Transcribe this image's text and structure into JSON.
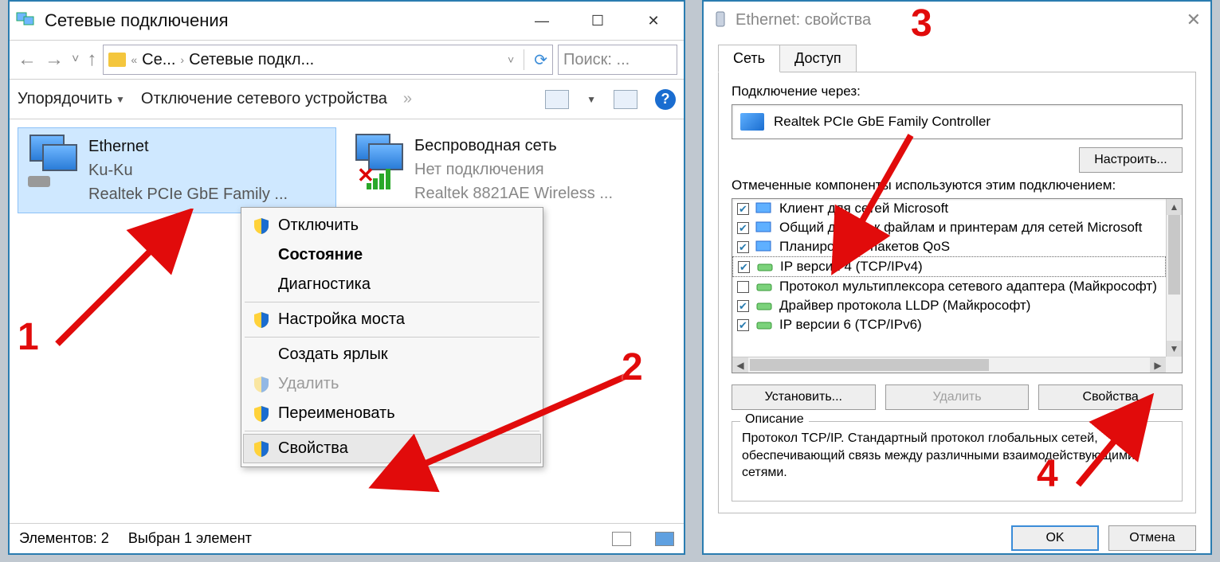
{
  "left_window": {
    "title": "Сетевые подключения",
    "breadcrumb_short": "Се...",
    "breadcrumb_current": "Сетевые подкл...",
    "search_placeholder": "Поиск: ...",
    "toolbar": {
      "organize": "Упорядочить",
      "disable": "Отключение сетевого устройства"
    },
    "connections": [
      {
        "name": "Ethernet",
        "line2": "Ku-Ku",
        "line3": "Realtek PCIe GbE Family ...",
        "selected": true,
        "type": "wired"
      },
      {
        "name": "Беспроводная сеть",
        "line2": "Нет подключения",
        "line3": "Realtek 8821AE Wireless ...",
        "selected": false,
        "type": "wifi_off"
      }
    ],
    "context_menu": [
      {
        "label": "Отключить",
        "shield": true
      },
      {
        "label": "Состояние",
        "bold": true
      },
      {
        "label": "Диагностика"
      },
      {
        "sep": true
      },
      {
        "label": "Настройка моста",
        "shield": true
      },
      {
        "sep": true
      },
      {
        "label": "Создать ярлык"
      },
      {
        "label": "Удалить",
        "shield": true,
        "disabled": true
      },
      {
        "label": "Переименовать",
        "shield": true
      },
      {
        "sep": true
      },
      {
        "label": "Свойства",
        "shield": true,
        "hover": true
      }
    ],
    "statusbar": {
      "elements": "Элементов: 2",
      "selected": "Выбран 1 элемент"
    }
  },
  "right_window": {
    "title": "Ethernet: свойства",
    "tabs": {
      "network": "Сеть",
      "access": "Доступ"
    },
    "connect_via_label": "Подключение через:",
    "adapter": "Realtek PCIe GbE Family Controller",
    "configure_btn": "Настроить...",
    "components_label": "Отмеченные компоненты используются этим подключением:",
    "components": [
      {
        "checked": true,
        "label": "Клиент для сетей Microsoft",
        "ico": "mon"
      },
      {
        "checked": true,
        "label": "Общий доступ к файлам и принтерам для сетей Microsoft",
        "ico": "mon"
      },
      {
        "checked": true,
        "label": "Планировщик пакетов QoS",
        "ico": "mon"
      },
      {
        "checked": true,
        "label": "IP версии 4 (TCP/IPv4)",
        "ico": "net",
        "highlighted": true
      },
      {
        "checked": false,
        "label": "Протокол мультиплексора сетевого адаптера (Майкрософт)",
        "ico": "net"
      },
      {
        "checked": true,
        "label": "Драйвер протокола LLDP (Майкрософт)",
        "ico": "net"
      },
      {
        "checked": true,
        "label": "IP версии 6 (TCP/IPv6)",
        "ico": "net"
      }
    ],
    "btn_install": "Установить...",
    "btn_remove": "Удалить",
    "btn_props": "Свойства",
    "desc_legend": "Описание",
    "desc_text": "Протокол TCP/IP. Стандартный протокол глобальных сетей, обеспечивающий связь между различными взаимодействующими сетями.",
    "ok": "OK",
    "cancel": "Отмена"
  },
  "annotations": {
    "n1": "1",
    "n2": "2",
    "n3": "3",
    "n4": "4"
  }
}
